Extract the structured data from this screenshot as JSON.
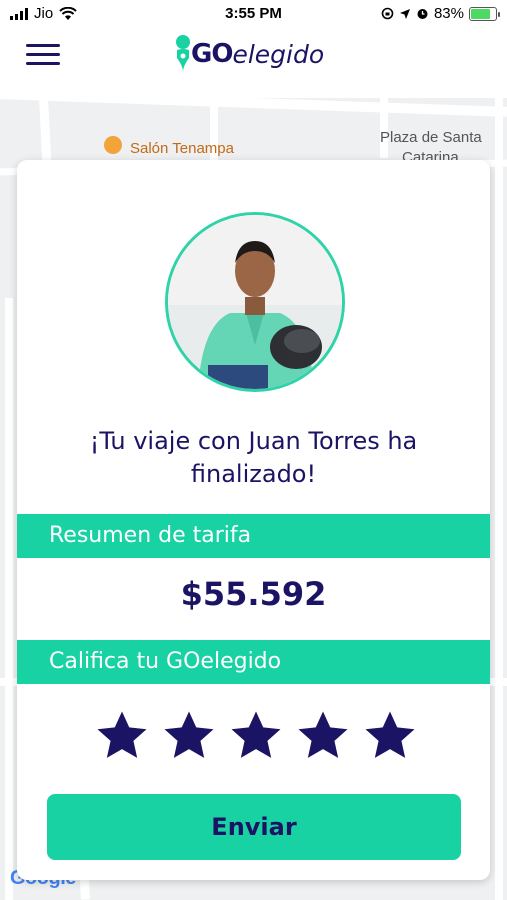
{
  "status_bar": {
    "carrier": "Jio",
    "time": "3:55 PM",
    "battery": "83%",
    "battery_level": 0.83
  },
  "header": {
    "menu_icon": "hamburger-icon",
    "logo_go": "GO",
    "logo_rest": "elegido",
    "logo_icon": "location-pin-icon"
  },
  "map": {
    "label_1": "Salón Tenampa",
    "label_2": "Plaza de Santa",
    "label_3": "Catarina",
    "google": "Google"
  },
  "card": {
    "message": "¡Tu viaje con Juan Torres ha finalizado!",
    "fare_section_title": "Resumen de tarifa",
    "fare_amount": "$55.592",
    "rating_section_title": "Califica tu GOelegido",
    "stars_total": 5,
    "submit_label": "Enviar"
  },
  "colors": {
    "brand_navy": "#1b1464",
    "brand_green": "#19d2a3"
  }
}
